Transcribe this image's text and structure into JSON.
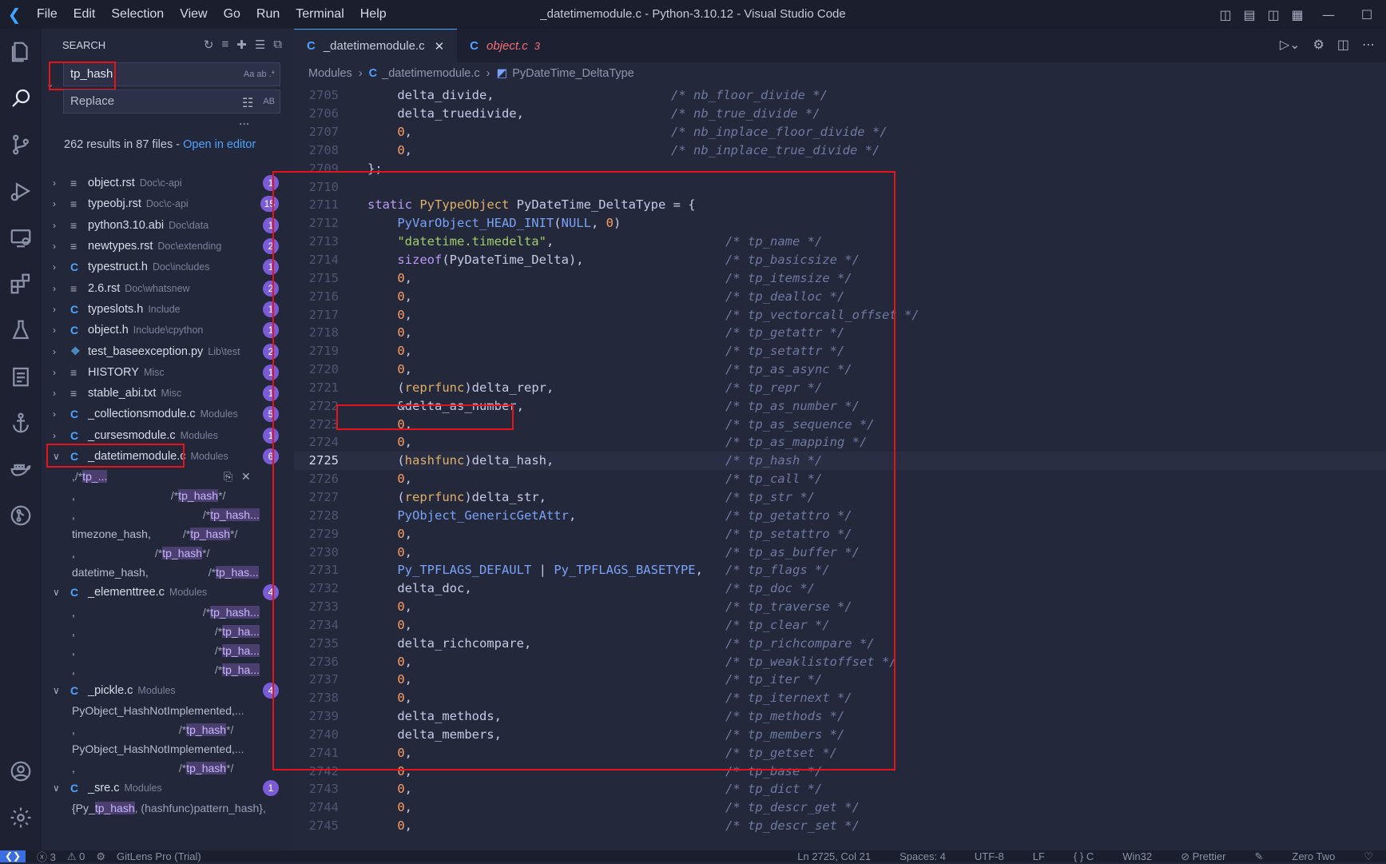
{
  "window": {
    "title": "_datetimemodule.c - Python-3.10.12 - Visual Studio Code",
    "menu": [
      "File",
      "Edit",
      "Selection",
      "View",
      "Go",
      "Run",
      "Terminal",
      "Help"
    ]
  },
  "sidebar": {
    "header": "SEARCH",
    "search_value": "tp_hash",
    "search_opts": "Aa  ab  .*",
    "replace_placeholder": "Replace",
    "replace_opts": "AB",
    "more": "...",
    "results_text": "262 results in 87 files - ",
    "results_link": "Open in editor",
    "files": [
      {
        "icon": "doc",
        "name": "object.rst",
        "path": "Doc\\c-api",
        "count": "1"
      },
      {
        "icon": "doc",
        "name": "typeobj.rst",
        "path": "Doc\\c-api",
        "count": "15"
      },
      {
        "icon": "doc",
        "name": "python3.10.abi",
        "path": "Doc\\data",
        "count": "1"
      },
      {
        "icon": "doc",
        "name": "newtypes.rst",
        "path": "Doc\\extending",
        "count": "2"
      },
      {
        "icon": "c",
        "name": "typestruct.h",
        "path": "Doc\\includes",
        "count": "1"
      },
      {
        "icon": "doc",
        "name": "2.6.rst",
        "path": "Doc\\whatsnew",
        "count": "2"
      },
      {
        "icon": "c",
        "name": "typeslots.h",
        "path": "Include",
        "count": "1"
      },
      {
        "icon": "c",
        "name": "object.h",
        "path": "Include\\cpython",
        "count": "1"
      },
      {
        "icon": "py",
        "name": "test_baseexception.py",
        "path": "Lib\\test",
        "count": "2"
      },
      {
        "icon": "doc",
        "name": "HISTORY",
        "path": "Misc",
        "count": "1"
      },
      {
        "icon": "doc",
        "name": "stable_abi.txt",
        "path": "Misc",
        "count": "1"
      },
      {
        "icon": "c",
        "name": "_collectionsmodule.c",
        "path": "Modules",
        "count": "5"
      },
      {
        "icon": "c",
        "name": "_cursesmodule.c",
        "path": "Modules",
        "count": "1"
      }
    ],
    "datetime_file": {
      "icon": "c",
      "name": "_datetimemodule.c",
      "path": "Modules",
      "count": "6"
    },
    "datetime_matches": [
      {
        "pre": ",",
        "cm": "/* ",
        "hl": "tp_...",
        "post": ""
      },
      {
        "pre": ",",
        "cm": "/* ",
        "hl": "tp_hash",
        "post": " */"
      },
      {
        "pre": ",",
        "cm": "/* ",
        "hl": "tp_hash...",
        "post": ""
      },
      {
        "pre": "timezone_hash,",
        "cm": "/* ",
        "hl": "tp_hash",
        "post": " */"
      },
      {
        "pre": ",",
        "cm": "/* ",
        "hl": "tp_hash",
        "post": " */"
      },
      {
        "pre": "datetime_hash,",
        "cm": "/* ",
        "hl": "tp_has...",
        "post": ""
      }
    ],
    "elementtree_file": {
      "icon": "c",
      "name": "_elementtree.c",
      "path": "Modules",
      "count": "4"
    },
    "elementtree_matches": [
      {
        "pre": ",",
        "cm": "/* ",
        "hl": "tp_hash...",
        "post": ""
      },
      {
        "pre": ",",
        "cm": "/* ",
        "hl": "tp_ha...",
        "post": ""
      },
      {
        "pre": ",",
        "cm": "/* ",
        "hl": "tp_ha...",
        "post": ""
      },
      {
        "pre": ",",
        "cm": "/* ",
        "hl": "tp_ha...",
        "post": ""
      }
    ],
    "pickle_file": {
      "icon": "c",
      "name": "_pickle.c",
      "path": "Modules",
      "count": "4"
    },
    "pickle_matches": [
      {
        "pre": "PyObject_HashNotImplemented,",
        "cm": "",
        "hl": "",
        "post": "..."
      },
      {
        "pre": ",",
        "cm": "/*",
        "hl": "tp_hash",
        "post": "*/"
      },
      {
        "pre": "PyObject_HashNotImplemented,",
        "cm": "",
        "hl": "",
        "post": "..."
      },
      {
        "pre": ",",
        "cm": "/*",
        "hl": "tp_hash",
        "post": "*/"
      }
    ],
    "sre_file": {
      "icon": "c",
      "name": "_sre.c",
      "path": "Modules",
      "count": "1"
    },
    "sre_matches": [
      {
        "pre": "{Py_",
        "cm": "",
        "hl": "tp_hash",
        "post": ", (hashfunc)pattern_hash},"
      }
    ]
  },
  "tabs": [
    {
      "name": "_datetimemodule.c",
      "active": true
    },
    {
      "name": "object.c",
      "count": "3",
      "active": false
    }
  ],
  "breadcrumb": [
    "Modules",
    "_datetimemodule.c",
    "PyDateTime_DeltaType"
  ],
  "code": {
    "current_line": "2725",
    "lines": [
      {
        "n": "2705",
        "src": "    delta_divide,",
        "cmt": "/* nb_floor_divide */",
        "col": "a"
      },
      {
        "n": "2706",
        "src": "    delta_truedivide,",
        "cmt": "/* nb_true_divide */",
        "col": "a"
      },
      {
        "n": "2707",
        "src": "    0,",
        "cmt": "/* nb_inplace_floor_divide */",
        "col": "a"
      },
      {
        "n": "2708",
        "src": "    0,",
        "cmt": "/* nb_inplace_true_divide */",
        "col": "a"
      },
      {
        "n": "2709",
        "src": "};",
        "cmt": "",
        "col": "a"
      },
      {
        "n": "2710",
        "src": "",
        "cmt": "",
        "col": "a"
      },
      {
        "n": "2711",
        "src": "static PyTypeObject PyDateTime_DeltaType = {",
        "cmt": "",
        "col": "b"
      },
      {
        "n": "2712",
        "src": "    PyVarObject_HEAD_INIT(NULL, 0)",
        "cmt": "",
        "col": "b"
      },
      {
        "n": "2713",
        "src": "    \"datetime.timedelta\",",
        "cmt": "/* tp_name */",
        "col": "b"
      },
      {
        "n": "2714",
        "src": "    sizeof(PyDateTime_Delta),",
        "cmt": "/* tp_basicsize */",
        "col": "b"
      },
      {
        "n": "2715",
        "src": "    0,",
        "cmt": "/* tp_itemsize */",
        "col": "b"
      },
      {
        "n": "2716",
        "src": "    0,",
        "cmt": "/* tp_dealloc */",
        "col": "b"
      },
      {
        "n": "2717",
        "src": "    0,",
        "cmt": "/* tp_vectorcall_offset */",
        "col": "b"
      },
      {
        "n": "2718",
        "src": "    0,",
        "cmt": "/* tp_getattr */",
        "col": "b"
      },
      {
        "n": "2719",
        "src": "    0,",
        "cmt": "/* tp_setattr */",
        "col": "b"
      },
      {
        "n": "2720",
        "src": "    0,",
        "cmt": "/* tp_as_async */",
        "col": "b"
      },
      {
        "n": "2721",
        "src": "    (reprfunc)delta_repr,",
        "cmt": "/* tp_repr */",
        "col": "b"
      },
      {
        "n": "2722",
        "src": "    &delta_as_number,",
        "cmt": "/* tp_as_number */",
        "col": "b"
      },
      {
        "n": "2723",
        "src": "    0,",
        "cmt": "/* tp_as_sequence */",
        "col": "b"
      },
      {
        "n": "2724",
        "src": "    0,",
        "cmt": "/* tp_as_mapping */",
        "col": "b"
      },
      {
        "n": "2725",
        "src": "    (hashfunc)delta_hash,",
        "cmt": "/* tp_hash */",
        "col": "b"
      },
      {
        "n": "2726",
        "src": "    0,",
        "cmt": "/* tp_call */",
        "col": "b"
      },
      {
        "n": "2727",
        "src": "    (reprfunc)delta_str,",
        "cmt": "/* tp_str */",
        "col": "b"
      },
      {
        "n": "2728",
        "src": "    PyObject_GenericGetAttr,",
        "cmt": "/* tp_getattro */",
        "col": "b"
      },
      {
        "n": "2729",
        "src": "    0,",
        "cmt": "/* tp_setattro */",
        "col": "b"
      },
      {
        "n": "2730",
        "src": "    0,",
        "cmt": "/* tp_as_buffer */",
        "col": "b"
      },
      {
        "n": "2731",
        "src": "    Py_TPFLAGS_DEFAULT | Py_TPFLAGS_BASETYPE,",
        "cmt": "/* tp_flags */",
        "col": "b"
      },
      {
        "n": "2732",
        "src": "    delta_doc,",
        "cmt": "/* tp_doc */",
        "col": "b"
      },
      {
        "n": "2733",
        "src": "    0,",
        "cmt": "/* tp_traverse */",
        "col": "b"
      },
      {
        "n": "2734",
        "src": "    0,",
        "cmt": "/* tp_clear */",
        "col": "b"
      },
      {
        "n": "2735",
        "src": "    delta_richcompare,",
        "cmt": "/* tp_richcompare */",
        "col": "b"
      },
      {
        "n": "2736",
        "src": "    0,",
        "cmt": "/* tp_weaklistoffset */",
        "col": "b"
      },
      {
        "n": "2737",
        "src": "    0,",
        "cmt": "/* tp_iter */",
        "col": "b"
      },
      {
        "n": "2738",
        "src": "    0,",
        "cmt": "/* tp_iternext */",
        "col": "b"
      },
      {
        "n": "2739",
        "src": "    delta_methods,",
        "cmt": "/* tp_methods */",
        "col": "b"
      },
      {
        "n": "2740",
        "src": "    delta_members,",
        "cmt": "/* tp_members */",
        "col": "b"
      },
      {
        "n": "2741",
        "src": "    0,",
        "cmt": "/* tp_getset */",
        "col": "b"
      },
      {
        "n": "2742",
        "src": "    0,",
        "cmt": "/* tp_base */",
        "col": "b"
      },
      {
        "n": "2743",
        "src": "    0,",
        "cmt": "/* tp_dict */",
        "col": "b"
      },
      {
        "n": "2744",
        "src": "    0,",
        "cmt": "/* tp_descr_get */",
        "col": "b"
      },
      {
        "n": "2745",
        "src": "    0,",
        "cmt": "/* tp_descr_set */",
        "col": "b"
      }
    ]
  },
  "status": {
    "errors": "ⓧ 3",
    "warnings": "⚠ 0",
    "gitlens": "GitLens Pro (Trial)",
    "position": "Ln 2725, Col 21",
    "spaces": "Spaces: 4",
    "encoding": "UTF-8",
    "eol": "LF",
    "language": "{ } C",
    "platform": "Win32",
    "prettier": "⊘ Prettier",
    "theme": "Zero Two"
  },
  "colors": {
    "highlight_box": "#e8121b",
    "badge": "#7b5cd6",
    "accent": "#4ea3ff"
  }
}
